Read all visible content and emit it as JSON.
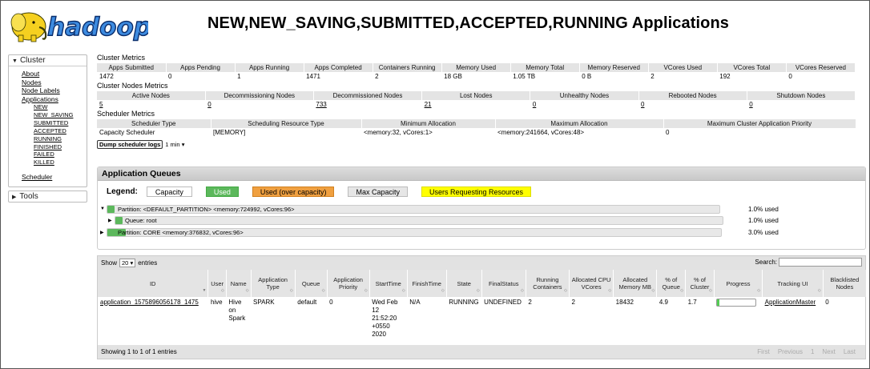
{
  "header": {
    "logo_text": "hadoop",
    "title": "NEW,NEW_SAVING,SUBMITTED,ACCEPTED,RUNNING Applications"
  },
  "nav": {
    "cluster_label": "Cluster",
    "items": [
      "About",
      "Nodes",
      "Node Labels",
      "Applications"
    ],
    "app_states": [
      "NEW",
      "NEW_SAVING",
      "SUBMITTED",
      "ACCEPTED",
      "RUNNING",
      "FINISHED",
      "FAILED",
      "KILLED"
    ],
    "scheduler_label": "Scheduler",
    "tools_label": "Tools"
  },
  "cluster_metrics": {
    "title": "Cluster Metrics",
    "headers": [
      "Apps Submitted",
      "Apps Pending",
      "Apps Running",
      "Apps Completed",
      "Containers Running",
      "Memory Used",
      "Memory Total",
      "Memory Reserved",
      "VCores Used",
      "VCores Total",
      "VCores Reserved"
    ],
    "values": [
      "1472",
      "0",
      "1",
      "1471",
      "2",
      "18 GB",
      "1.05 TB",
      "0 B",
      "2",
      "192",
      "0"
    ]
  },
  "node_metrics": {
    "title": "Cluster Nodes Metrics",
    "headers": [
      "Active Nodes",
      "Decommissioning Nodes",
      "Decommissioned Nodes",
      "Lost Nodes",
      "Unhealthy Nodes",
      "Rebooted Nodes",
      "Shutdown Nodes"
    ],
    "values": [
      "5",
      "0",
      "733",
      "21",
      "0",
      "0",
      "0"
    ]
  },
  "scheduler_metrics": {
    "title": "Scheduler Metrics",
    "headers": [
      "Scheduler Type",
      "Scheduling Resource Type",
      "Minimum Allocation",
      "Maximum Allocation",
      "Maximum Cluster Application Priority"
    ],
    "values": [
      "Capacity Scheduler",
      "[MEMORY]",
      "<memory:32, vCores:1>",
      "<memory:241664, vCores:48>",
      "0"
    ]
  },
  "dump": {
    "button": "Dump scheduler logs",
    "select": "1 min"
  },
  "queues": {
    "title": "Application Queues",
    "legend_title": "Legend:",
    "legend": {
      "capacity": "Capacity",
      "used": "Used",
      "over": "Used (over capacity)",
      "max": "Max Capacity",
      "users": "Users Requesting Resources"
    },
    "rows": [
      {
        "label": "Partition: <DEFAULT_PARTITION> <memory:724992, vCores:96>",
        "pct": "1.0% used",
        "used": 0.01
      },
      {
        "label": "Queue: root",
        "pct": "1.0% used",
        "used": 0.01
      },
      {
        "label": "Partition: CORE <memory:376832, vCores:96>",
        "pct": "3.0% used",
        "used": 0.03
      }
    ]
  },
  "apps": {
    "show": "Show",
    "entries_count": "20",
    "entries": "entries",
    "search_label": "Search:",
    "search_value": "",
    "columns": [
      "ID",
      "User",
      "Name",
      "Application Type",
      "Queue",
      "Application Priority",
      "StartTime",
      "FinishTime",
      "State",
      "FinalStatus",
      "Running Containers",
      "Allocated CPU VCores",
      "Allocated Memory MB",
      "% of Queue",
      "% of Cluster",
      "Progress",
      "Tracking UI",
      "Blacklisted Nodes"
    ],
    "row": {
      "id": "application_1575896056178_1475",
      "user": "hive",
      "name": "Hive on Spark",
      "type": "SPARK",
      "queue": "default",
      "priority": "0",
      "start": "Wed Feb 12 21:52:20 +0550 2020",
      "finish": "N/A",
      "state": "RUNNING",
      "final": "UNDEFINED",
      "containers": "2",
      "vcores": "2",
      "memory": "18432",
      "pct_queue": "4.9",
      "pct_cluster": "1.7",
      "progress": 0.06,
      "tracking": "ApplicationMaster",
      "blacklisted": "0"
    },
    "footer": "Showing 1 to 1 of 1 entries",
    "pager": [
      "First",
      "Previous",
      "1",
      "Next",
      "Last"
    ]
  }
}
